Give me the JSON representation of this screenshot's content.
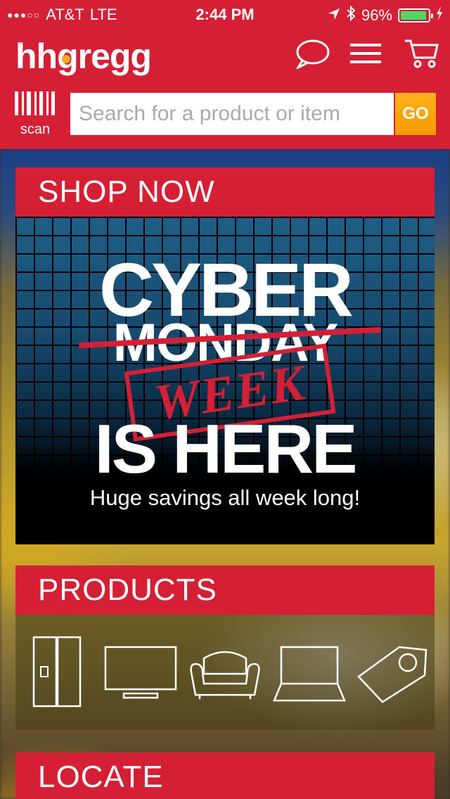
{
  "status_bar": {
    "signal": "●●●○○",
    "carrier": "AT&T",
    "network": "LTE",
    "time": "2:44 PM",
    "battery": "96%"
  },
  "header": {
    "logo": "hhgregg",
    "icons": [
      "chat-icon",
      "menu-icon",
      "cart-icon"
    ]
  },
  "search": {
    "scan_label": "scan",
    "placeholder": "Search for a product or item",
    "value": "",
    "go_label": "GO"
  },
  "shop_now": {
    "heading": "SHOP NOW",
    "banner": {
      "line1": "CYBER",
      "line2": "MONDAY",
      "stamp": "WEEK",
      "line3": "IS HERE",
      "tagline": "Huge savings all week long!"
    }
  },
  "products": {
    "heading": "PRODUCTS",
    "categories": [
      "refrigerator-icon",
      "tv-icon",
      "sofa-icon",
      "laptop-icon",
      "price-tag-icon"
    ]
  },
  "locate": {
    "heading": "LOCATE"
  },
  "colors": {
    "brand_red": "#d41f35",
    "go_orange": "#f59a00",
    "battery_green": "#4cd964"
  }
}
